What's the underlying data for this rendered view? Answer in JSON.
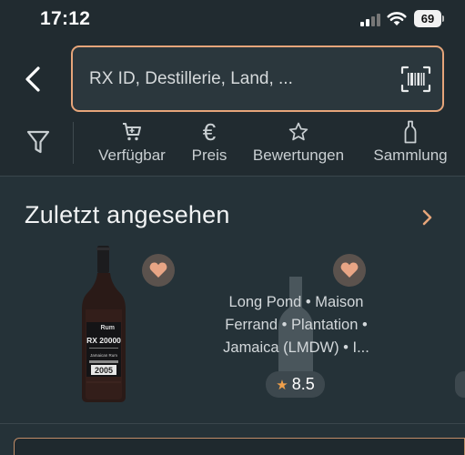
{
  "status_bar": {
    "time": "17:12",
    "battery": "69"
  },
  "search": {
    "placeholder": "RX ID, Destillerie, Land, ...",
    "border_color": "#e6a57a"
  },
  "filters": [
    {
      "icon": "cart-icon",
      "label": "Verfügbar"
    },
    {
      "icon": "euro-icon",
      "label": "Preis"
    },
    {
      "icon": "star-outline-icon",
      "label": "Bewertungen"
    },
    {
      "icon": "bottle-icon",
      "label": "Sammlung"
    }
  ],
  "recent": {
    "title": "Zuletzt angesehen",
    "items": [
      {
        "label_brand": "Rum",
        "label_code": "RX 20000",
        "label_sub": "Jamaican Rum",
        "label_year": "2005"
      },
      {
        "text": "Long Pond • Maison Ferrand • Plantation • Jamaica (LMDW) • I...",
        "rating": "8.5"
      }
    ]
  },
  "colors": {
    "accent": "#e6a57a",
    "background": "#253238",
    "heart": "#e8a585",
    "star": "#f0a04b"
  }
}
